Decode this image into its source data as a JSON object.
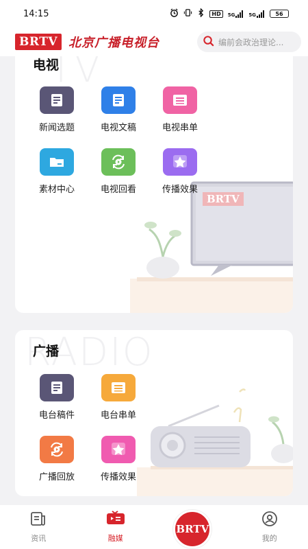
{
  "status_bar": {
    "time": "14:15",
    "icons": [
      "alarm-icon",
      "vibrate-icon",
      "bluetooth-icon",
      "hd-icon",
      "signal-5g-icon",
      "signal-5g-icon",
      "battery-icon"
    ],
    "hd_label": "HD",
    "net1_label": "5G",
    "net2_label": "5G",
    "battery": "56"
  },
  "header": {
    "logo_text": "BRTV",
    "station_name": "北京广播电视台",
    "search_placeholder": "编前会政治理论..."
  },
  "tv_section": {
    "title": "电视",
    "watermark": "TV",
    "screen_logo": "BRTV",
    "items": [
      {
        "label": "新闻选题",
        "icon": "document-icon",
        "color": "#5a5676"
      },
      {
        "label": "电视文稿",
        "icon": "document-icon",
        "color": "#2f80e8"
      },
      {
        "label": "电视串单",
        "icon": "list-icon",
        "color": "#f063a4"
      },
      {
        "label": "素材中心",
        "icon": "folder-icon",
        "color": "#2ea8e0"
      },
      {
        "label": "电视回看",
        "icon": "replay-icon",
        "color": "#6cbf5a"
      },
      {
        "label": "传播效果",
        "icon": "star-icon",
        "color": "#9b6cf0"
      }
    ]
  },
  "radio_section": {
    "title": "广播",
    "watermark": "RADIO",
    "items": [
      {
        "label": "电台稿件",
        "icon": "document-icon",
        "color": "#5a5676"
      },
      {
        "label": "电台串单",
        "icon": "list-icon",
        "color": "#f6a93b"
      },
      {
        "label": "广播回放",
        "icon": "replay-icon",
        "color": "#f27a45"
      },
      {
        "label": "传播效果",
        "icon": "star-icon",
        "color": "#f05bb0"
      }
    ]
  },
  "bottom_nav": {
    "items": [
      {
        "label": "资讯",
        "icon": "news-icon",
        "active": false
      },
      {
        "label": "融媒",
        "icon": "media-icon",
        "active": true
      },
      {
        "label": "",
        "icon": "brtv-logo-icon",
        "active": false
      },
      {
        "label": "我的",
        "icon": "profile-icon",
        "active": false
      }
    ],
    "center_logo": "BRTV",
    "accent": "#d7252c"
  }
}
